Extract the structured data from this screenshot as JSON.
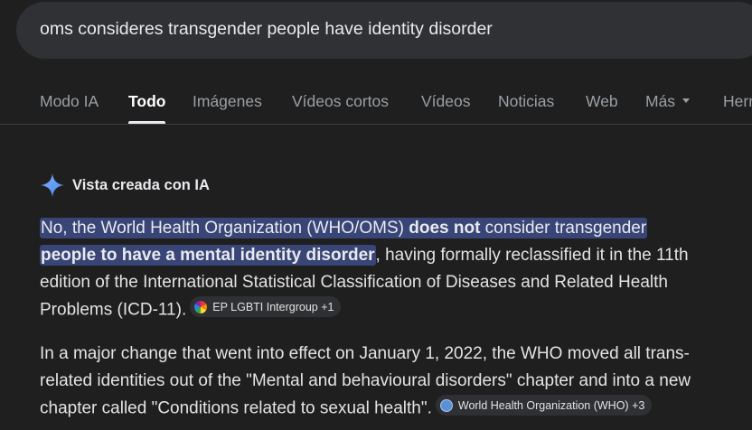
{
  "search": {
    "query": "oms consideres transgender people have identity disorder"
  },
  "tabs": [
    {
      "label": "Modo IA"
    },
    {
      "label": "Todo"
    },
    {
      "label": "Imágenes"
    },
    {
      "label": "Vídeos cortos"
    },
    {
      "label": "Vídeos"
    },
    {
      "label": "Noticias"
    },
    {
      "label": "Web"
    },
    {
      "label": "Más"
    },
    {
      "label": "Herr"
    }
  ],
  "ai_overview": {
    "header": "Vista creada con IA",
    "p1": {
      "hl_a": "No, the World Health Organization (WHO/OMS) ",
      "hl_b": "does not",
      "hl_c": " consider transgender",
      "hl_d": "people to have a mental identity disorder",
      "rest_line2": ", having formally reclassified it in the 11th",
      "line3": "edition of the International Statistical Classification of Diseases and Related Health",
      "line4": "Problems (ICD-11).",
      "chip": "EP LGBTI Intergroup +1"
    },
    "p2": {
      "line1": "In a major change that went into effect on January 1, 2022, the WHO moved all trans-",
      "line2": "related identities out of the \"Mental and behavioural disorders\" chapter and into a new",
      "line3": "chapter called \"Conditions related to sexual health\".",
      "chip": "World Health Organization (WHO) +3"
    }
  },
  "colors": {
    "background": "#1f1f1f",
    "highlight": "#384576",
    "searchbar": "#303134"
  }
}
